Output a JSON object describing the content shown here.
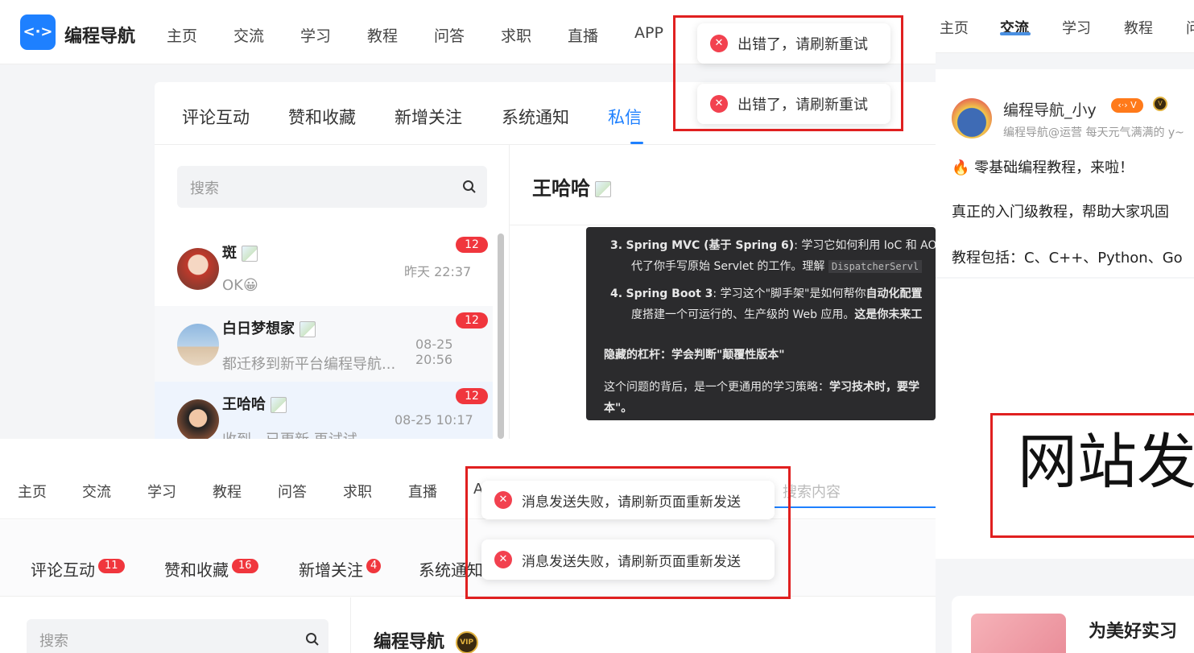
{
  "top": {
    "logo_text": "编程导航",
    "nav": [
      "主页",
      "交流",
      "学习",
      "教程",
      "问答",
      "求职",
      "直播",
      "APP"
    ],
    "toast1": "出错了，请刷新重试",
    "toast2": "出错了，请刷新重试"
  },
  "messages": {
    "tabs": [
      "评论互动",
      "赞和收藏",
      "新增关注",
      "系统通知",
      "私信"
    ],
    "active_tab": "私信",
    "search_placeholder": "搜索",
    "conversations": [
      {
        "name": "斑",
        "preview": "OK😀",
        "time": "昨天 22:37",
        "count": "12"
      },
      {
        "name": "白日梦想家",
        "preview": "都迁移到新平台编程导航...",
        "time": "08-25 20:56",
        "count": "12"
      },
      {
        "name": "王哈哈",
        "preview": "收到，已更新,再试试",
        "time": "08-25 10:17",
        "count": "12"
      }
    ],
    "chat_title": "王哈哈",
    "chat_lines": {
      "item3_num": "3.",
      "item3_bold": "Spring MVC (基于 Spring 6)",
      "item3_text": ": 学习它如何利用 IoC 和 AO",
      "item3_line2": "代了你手写原始 Servlet 的工作。理解",
      "item3_code": "DispatcherServl",
      "item4_num": "4.",
      "item4_bold": "Spring Boot 3",
      "item4_text": ": 学习这个\"脚手架\"是如何帮你",
      "item4_bold2": "自动化配置",
      "item4_line2": "度搭建一个可运行的、生产级的 Web 应用。",
      "item4_bold3": "这是你未来工",
      "hidden_title": "隐藏的杠杆：学会判断\"颠覆性版本\"",
      "para1": "这个问题的背后，是一个更通用的学习策略：",
      "para1_bold": "学习技术时，要学",
      "para2": "本\"。"
    }
  },
  "right": {
    "nav": [
      "主页",
      "交流",
      "学习",
      "教程",
      "问"
    ],
    "active_nav": "交流",
    "author": "编程导航_小y",
    "author_meta": "编程导航@运营 每天元气满满的 y~",
    "post_line1": "🔥 零基础编程教程，来啦！",
    "post_line2": "真正的入门级教程，帮助大家巩固",
    "post_line3": "教程包括：C、C++、Python、Go",
    "big_text": "网站发",
    "card_title": "为美好实习"
  },
  "bottom": {
    "nav": [
      "主页",
      "交流",
      "学习",
      "教程",
      "问答",
      "求职",
      "直播",
      "A"
    ],
    "search_placeholder": "搜索内容",
    "tabs": [
      {
        "label": "评论互动",
        "badge": "11"
      },
      {
        "label": "赞和收藏",
        "badge": "16"
      },
      {
        "label": "新增关注",
        "badge": "4"
      },
      {
        "label": "系统通知",
        "badge": ""
      }
    ],
    "toast1": "消息发送失败，请刷新页面重新发送",
    "toast2": "消息发送失败，请刷新页面重新发送",
    "search_placeholder2": "搜索",
    "chat_title": "编程导航",
    "vip": "VIP"
  },
  "colors": {
    "accent": "#1e80ff",
    "error": "#f2414f",
    "highlight": "#e02020"
  }
}
